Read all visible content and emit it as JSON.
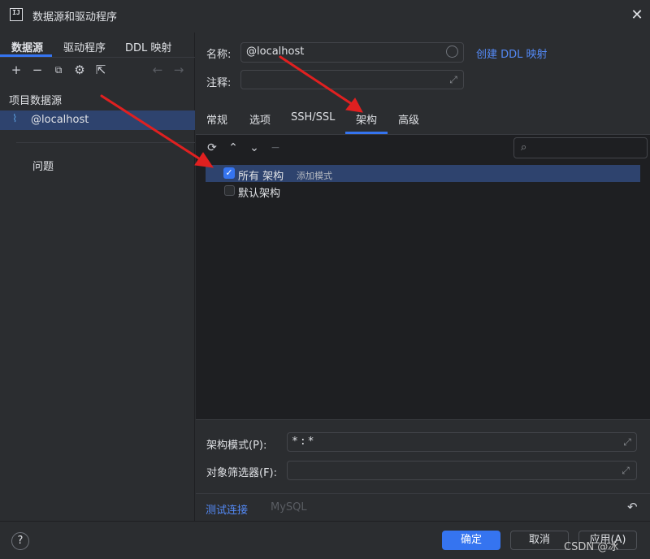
{
  "window": {
    "title": "数据源和驱动程序",
    "app_icon_text": "IJ"
  },
  "left": {
    "tabs": [
      "数据源",
      "驱动程序",
      "DDL 映射"
    ],
    "section_header": "项目数据源",
    "selected_item": "@localhost",
    "problems_label": "问题"
  },
  "form": {
    "name_label": "名称:",
    "name_value": "@localhost",
    "create_link": "创建 DDL 映射",
    "comment_label": "注释:",
    "comment_value": ""
  },
  "right_tabs": [
    "常规",
    "选项",
    "SSH/SSL",
    "架构",
    "高级"
  ],
  "active_tab": "架构",
  "schema_tree": {
    "rows": [
      {
        "label": "所有 架构",
        "hint": "添加模式",
        "checked": true,
        "selected": true
      },
      {
        "label": "默认架构",
        "hint": "",
        "checked": false,
        "selected": false
      }
    ]
  },
  "bottom": {
    "pattern_label": "架构模式(P):",
    "pattern_value": "*:*",
    "filter_label": "对象筛选器(F):",
    "filter_value": "",
    "test_link": "测试连接",
    "driver_label": "MySQL"
  },
  "footer": {
    "help": "?",
    "ok": "确定",
    "cancel": "取消",
    "apply": "应用(A)"
  },
  "watermark": "CSDN @冰",
  "colors": {
    "accent": "#3574f0",
    "link": "#548af7",
    "annotation_arrow": "#e02020"
  }
}
